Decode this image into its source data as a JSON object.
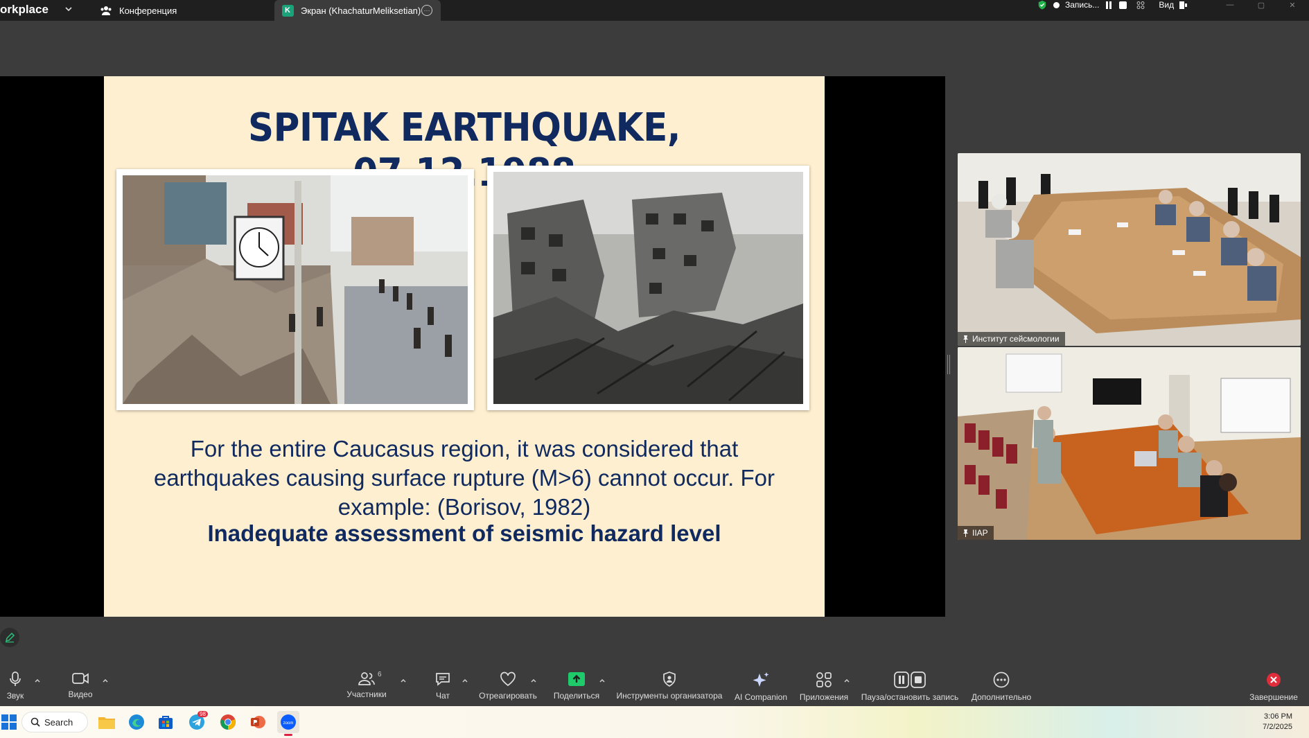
{
  "app": {
    "brand": "orkplace",
    "tabs": [
      {
        "label": "Конференция",
        "active": false
      },
      {
        "label": "Экран (KhachaturMeliksetian)",
        "badge": "K",
        "active": true
      }
    ],
    "recording": {
      "label": "Запись..."
    },
    "view": {
      "label": "Вид"
    }
  },
  "slide": {
    "title": "SPITAK EARTHQUAKE, 07.12.1988",
    "body_lines": [
      "For the entire Caucasus region, it was considered that",
      "earthquakes causing surface rupture (M>6) cannot occur. For",
      "example: (Borisov, 1982)"
    ],
    "bold_line": "Inadequate assessment of seismic hazard level"
  },
  "videos": [
    {
      "name": "Институт сейсмологии"
    },
    {
      "name": "IIAP"
    }
  ],
  "toolbar": {
    "audio": "Звук",
    "video": "Видео",
    "participants": "Участники",
    "participants_count": "6",
    "chat": "Чат",
    "react": "Отреагировать",
    "share": "Поделиться",
    "host_tools": "Инструменты организатора",
    "ai": "AI Companion",
    "apps": "Приложения",
    "record": "Пауза/остановить запись",
    "more": "Дополнительно",
    "end": "Завершение"
  },
  "taskbar": {
    "search": "Search",
    "telegram_badge": "98",
    "time": "3:06 PM",
    "date": "7/2/2025"
  },
  "colors": {
    "slide_bg": "#fdefcf",
    "slide_text": "#102a5f",
    "share_green": "#1fca6b",
    "end_red": "#e02d3c"
  }
}
